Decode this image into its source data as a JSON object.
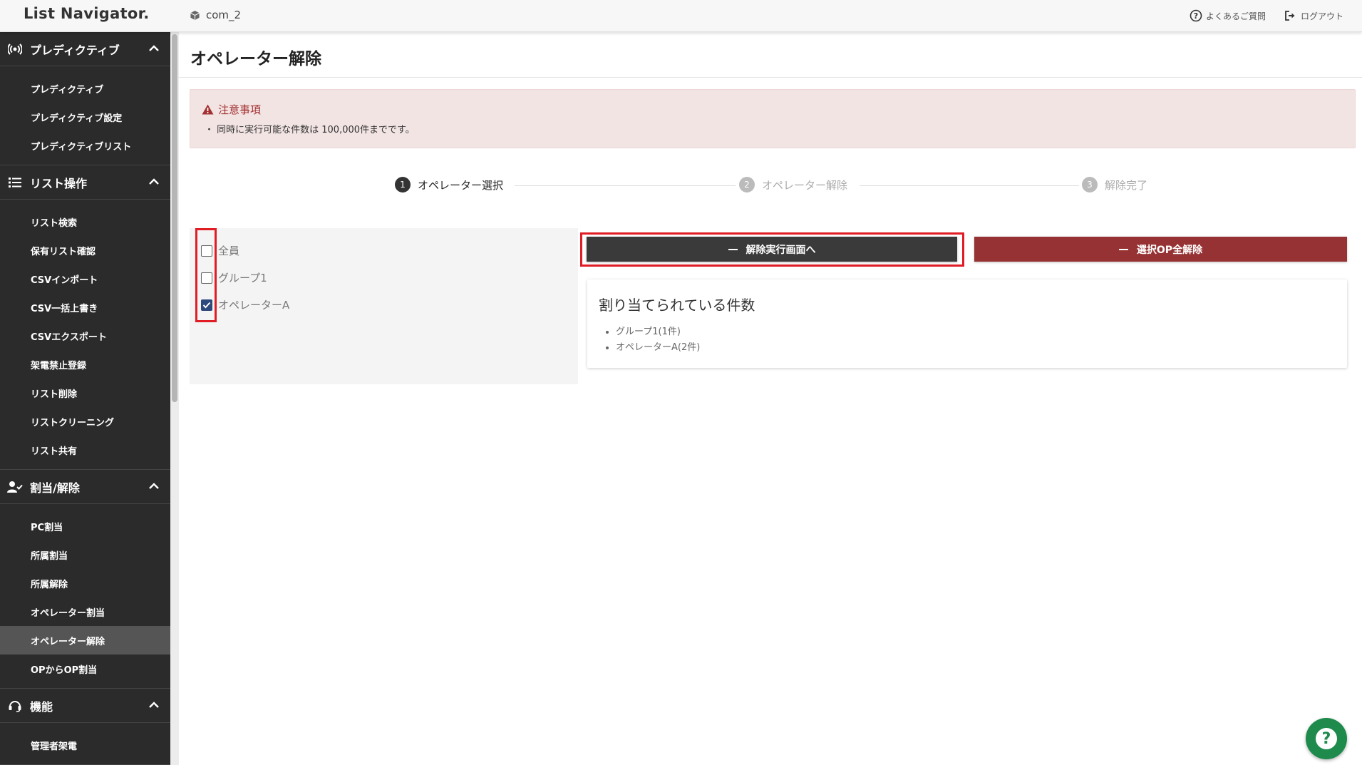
{
  "header": {
    "logo": "List Navigator.",
    "company": "com_2",
    "faq_label": "よくあるご質問",
    "logout_label": "ログアウト"
  },
  "sidebar": {
    "sections": [
      {
        "label": "プレディクティブ",
        "icon": "broadcast-icon",
        "items": [
          "プレディクティブ",
          "プレディクティブ設定",
          "プレディクティブリスト"
        ]
      },
      {
        "label": "リスト操作",
        "icon": "list-icon",
        "items": [
          "リスト検索",
          "保有リスト確認",
          "CSVインポート",
          "CSV一括上書き",
          "CSVエクスポート",
          "架電禁止登録",
          "リスト削除",
          "リストクリーニング",
          "リスト共有"
        ]
      },
      {
        "label": "割当/解除",
        "icon": "user-check-icon",
        "items": [
          "PC割当",
          "所属割当",
          "所属解除",
          "オペレーター割当",
          "オペレーター解除",
          "OPからOP割当"
        ]
      },
      {
        "label": "機能",
        "icon": "headset-icon",
        "items": [
          "管理者架電"
        ]
      }
    ],
    "active_item": "オペレーター解除"
  },
  "page": {
    "title": "オペレーター解除"
  },
  "alert": {
    "title": "注意事項",
    "text": "・ 同時に実行可能な件数は 100,000件までです。"
  },
  "stepper": [
    {
      "num": "1",
      "label": "オペレーター選択",
      "state": "active"
    },
    {
      "num": "2",
      "label": "オペレーター解除",
      "state": "inactive"
    },
    {
      "num": "3",
      "label": "解除完了",
      "state": "inactive"
    }
  ],
  "checklist": [
    {
      "label": "全員",
      "checked": false
    },
    {
      "label": "グループ1",
      "checked": false
    },
    {
      "label": "オペレーターA",
      "checked": true
    }
  ],
  "buttons": {
    "proceed": "解除実行画面へ",
    "release_all": "選択OP全解除"
  },
  "card": {
    "title": "割り当てられている件数",
    "items": [
      "グループ1(1件)",
      "オペレーターA(2件)"
    ]
  },
  "colors": {
    "sidebar_bg": "#2b2b2b",
    "accent_red": "#963233",
    "dark_button": "#3a3a3a",
    "checkbox_checked": "#2c4a7c",
    "highlight_box": "#e01c24",
    "help_fab": "#1e8a4c"
  }
}
